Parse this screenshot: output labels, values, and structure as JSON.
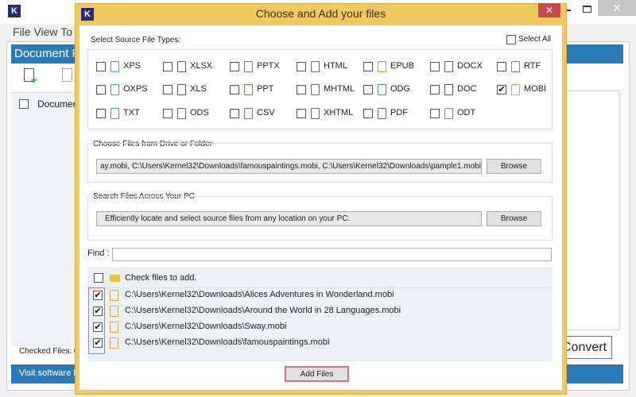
{
  "app": {
    "menu": [
      "File",
      "View",
      "To"
    ],
    "panel_title": "Document F",
    "list_header": "Documer",
    "checked_files": "Checked Files: 0",
    "footer": "Visit software h",
    "convert_label": "Convert"
  },
  "dialog": {
    "title": "Choose and Add your files",
    "source_types_label": "Select Source File Types:",
    "select_all": "Select All",
    "types": [
      {
        "label": "XPS",
        "checked": false,
        "color": "#3aa0d0"
      },
      {
        "label": "XLSX",
        "checked": false,
        "color": "#1e7d3a"
      },
      {
        "label": "PPTX",
        "checked": false,
        "color": "#d0583a"
      },
      {
        "label": "HTML",
        "checked": false,
        "color": "#5566c8"
      },
      {
        "label": "EPUB",
        "checked": false,
        "color": "#8cbf3a"
      },
      {
        "label": "DOCX",
        "checked": false,
        "color": "#3a5fc8"
      },
      {
        "label": "RTF",
        "checked": false,
        "color": "#3aa0d0"
      },
      {
        "label": "OXPS",
        "checked": false,
        "color": "#3aa0d0"
      },
      {
        "label": "XLS",
        "checked": false,
        "color": "#1e7d3a"
      },
      {
        "label": "PPT",
        "checked": false,
        "color": "#d0583a"
      },
      {
        "label": "MHTML",
        "checked": false,
        "color": "#5566c8"
      },
      {
        "label": "ODG",
        "checked": false,
        "color": "#2a9d8f"
      },
      {
        "label": "DOC",
        "checked": false,
        "color": "#3a4fa8"
      },
      {
        "label": "MOBI",
        "checked": true,
        "color": "#e8a33a"
      },
      {
        "label": "TXT",
        "checked": false,
        "color": "#3aa0d0"
      },
      {
        "label": "ODS",
        "checked": false,
        "color": "#3a6fc8"
      },
      {
        "label": "CSV",
        "checked": false,
        "color": "#3aa04a"
      },
      {
        "label": "XHTML",
        "checked": false,
        "color": "#5566c8"
      },
      {
        "label": "PDF",
        "checked": false,
        "color": "#d03a3a"
      },
      {
        "label": "ODT",
        "checked": false,
        "color": "#3aa0d0"
      }
    ],
    "drive_label": "Choose Files from Drive or Folder",
    "drive_value": "ay.mobi, C:\\Users\\Kernel32\\Downloads\\famouspaintings.mobi, C:\\Users\\Kernel32\\Downloads\\pample1.mobi]",
    "browse": "Browse",
    "search_label": "Search Files Across Your PC",
    "search_value": "Efficiently locate and select source files from any location on your PC.",
    "find_label": "Find :",
    "find_value": "",
    "list_header": "Check files to add.",
    "files": [
      {
        "path": "C:\\Users\\Kernel32\\Downloads\\Alices Adventures in Wonderland.mobi",
        "checked": true
      },
      {
        "path": "C:\\Users\\Kernel32\\Downloads\\Around the World in 28 Languages.mobi",
        "checked": true
      },
      {
        "path": "C:\\Users\\Kernel32\\Downloads\\Sway.mobi",
        "checked": true
      },
      {
        "path": "C:\\Users\\Kernel32\\Downloads\\famouspaintings.mobi",
        "checked": true
      }
    ],
    "add_files": "Add Files",
    "logo": "K"
  }
}
